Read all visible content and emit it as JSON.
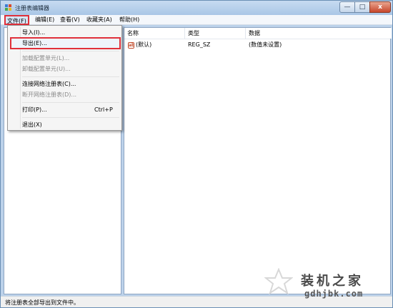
{
  "window": {
    "title": "注册表编辑器",
    "controls": {
      "minimize": "—",
      "maximize": "□",
      "close": "x"
    }
  },
  "menubar": {
    "items": [
      {
        "label": "文件(F)"
      },
      {
        "label": "编辑(E)"
      },
      {
        "label": "查看(V)"
      },
      {
        "label": "收藏夹(A)"
      },
      {
        "label": "帮助(H)"
      }
    ]
  },
  "file_menu": {
    "items": [
      {
        "label": "导入(I)..."
      },
      {
        "label": "导出(E)..."
      },
      {
        "label": "加载配置单元(L)..."
      },
      {
        "label": "卸载配置单元(U)..."
      },
      {
        "label": "连接网络注册表(C)..."
      },
      {
        "label": "断开网络注册表(D)..."
      },
      {
        "label": "打印(P)...",
        "shortcut": "Ctrl+P"
      },
      {
        "label": "退出(X)"
      }
    ]
  },
  "values_pane": {
    "columns": [
      "名称",
      "类型",
      "数据"
    ],
    "rows": [
      {
        "name": "(默认)",
        "type": "REG_SZ",
        "data": "(数值未设置)",
        "icon": "ab"
      }
    ]
  },
  "statusbar": {
    "text": "将注册表全部导出到文件中。"
  },
  "watermark": {
    "title": "装机之家",
    "subtitle": "gdhjbk.com"
  },
  "colors": {
    "highlight_box": "#e0303a",
    "titlebar": "#bcd2ea"
  }
}
